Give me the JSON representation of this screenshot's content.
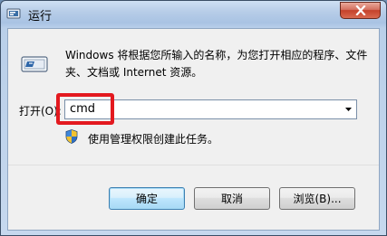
{
  "window": {
    "title": "运行",
    "close_icon": "close-icon"
  },
  "dialog": {
    "description": "Windows 将根据您所输入的名称，为您打开相应的程序、文件夹、文档或 Internet 资源。",
    "open_label": "打开(O):",
    "input_value": "cmd",
    "admin_note": "使用管理权限创建此任务。"
  },
  "buttons": {
    "ok": "确定",
    "cancel": "取消",
    "browse": "浏览(B)..."
  },
  "colors": {
    "highlight": "#e3191f",
    "close_button": "#c4412a"
  }
}
